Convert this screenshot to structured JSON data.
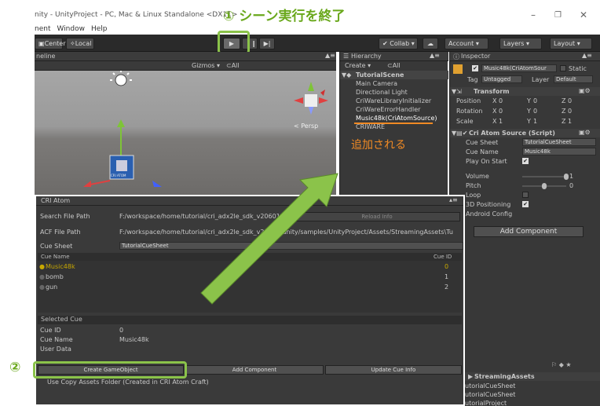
{
  "window": {
    "title": "nity - UnityProject - PC, Mac & Linux Standalone <DX11>",
    "controls": [
      "–",
      "❐",
      "✕"
    ]
  },
  "menu": [
    "nent",
    "Window",
    "Help"
  ],
  "annotation": {
    "step1": "① シーン実行を終了",
    "step2": "②",
    "added": "追加される"
  },
  "toolbar": {
    "center": "Center",
    "local": "Local",
    "play": "▶",
    "pause": "❙❙",
    "step": "▶|",
    "collab": "Collab ▾",
    "account": "Account ▾",
    "layers": "Layers ▾",
    "layout": "Layout ▾"
  },
  "scene": {
    "tab": "neline",
    "gizmos": "Gizmos ▾",
    "search": "⊂All",
    "persp": "< Persp",
    "object_label": "CRI ATOM"
  },
  "hierarchy": {
    "tab": "Hierarchy",
    "create": "Create ▾",
    "search": "⊂All",
    "scene": "TutorialScene",
    "items": [
      "Main Camera",
      "Directional Light",
      "CriWareLibraryInitializer",
      "CriWareErrorHandler",
      "Music48k(CriAtomSource)",
      "CRIWARE"
    ]
  },
  "inspector": {
    "tab": "Inspector",
    "object_name": "Music48k(CriAtomSour",
    "static": "Static",
    "tag_label": "Tag",
    "tag_value": "Untagged",
    "layer_label": "Layer",
    "layer_value": "Default",
    "transform": {
      "title": "Transform",
      "rows": [
        {
          "label": "Position",
          "x": "0",
          "y": "0",
          "z": "0"
        },
        {
          "label": "Rotation",
          "x": "0",
          "y": "0",
          "z": "0"
        },
        {
          "label": "Scale",
          "x": "1",
          "y": "1",
          "z": "1"
        }
      ]
    },
    "cri_source": {
      "title": "Cri Atom Source (Script)",
      "cue_sheet_label": "Cue Sheet",
      "cue_sheet_value": "TutorialCueSheet",
      "cue_name_label": "Cue Name",
      "cue_name_value": "Music48k",
      "play_on_start": "Play On Start",
      "volume_label": "Volume",
      "volume_value": "1",
      "volume_level": 1.0,
      "pitch_label": "Pitch",
      "pitch_value": "0",
      "pitch_level": 0.5,
      "loop": "Loop",
      "positioning": "3D Positioning",
      "android": "Android Config"
    },
    "add_component": "Add Component"
  },
  "cri_atom": {
    "tab": "CRI Atom",
    "search_label": "Search File Path",
    "search_value": "F:/workspace/home/tutorial/cri_adx2le_sdk_v20601/",
    "reload": "Reload Info",
    "acf_label": "ACF File Path",
    "acf_value": "F:/workspace/home/tutorial/cri_adx2le_sdk_v20601/unity/samples/UnityProject/Assets/StreamingAssets\\Tu",
    "cuesheet_label": "Cue Sheet",
    "cuesheet_value": "TutorialCueSheet",
    "col_name": "Cue Name",
    "col_id": "Cue ID",
    "cues": [
      {
        "name": "Music48k",
        "id": "0"
      },
      {
        "name": "bomb",
        "id": "1"
      },
      {
        "name": "gun",
        "id": "2"
      }
    ],
    "selected_cue": "Selected Cue",
    "cue_id_label": "Cue ID",
    "cue_id_value": "0",
    "cue_name_label": "Cue Name",
    "cue_name_value": "Music48k",
    "user_data_label": "User Data",
    "create_go": "Create GameObject",
    "add_component": "Add Component",
    "update_cue": "Update Cue Info",
    "copy_assets": "Use Copy Assets Folder (Created in CRI Atom Craft)"
  },
  "project": {
    "folder": "StreamingAssets",
    "files": [
      "utorialCueSheet",
      "utorialCueSheet",
      "utorialProject"
    ]
  },
  "colors": {
    "accent_green": "#8bc34a",
    "highlight_orange": "#f08a24",
    "cue_selected": "#c8a800"
  }
}
